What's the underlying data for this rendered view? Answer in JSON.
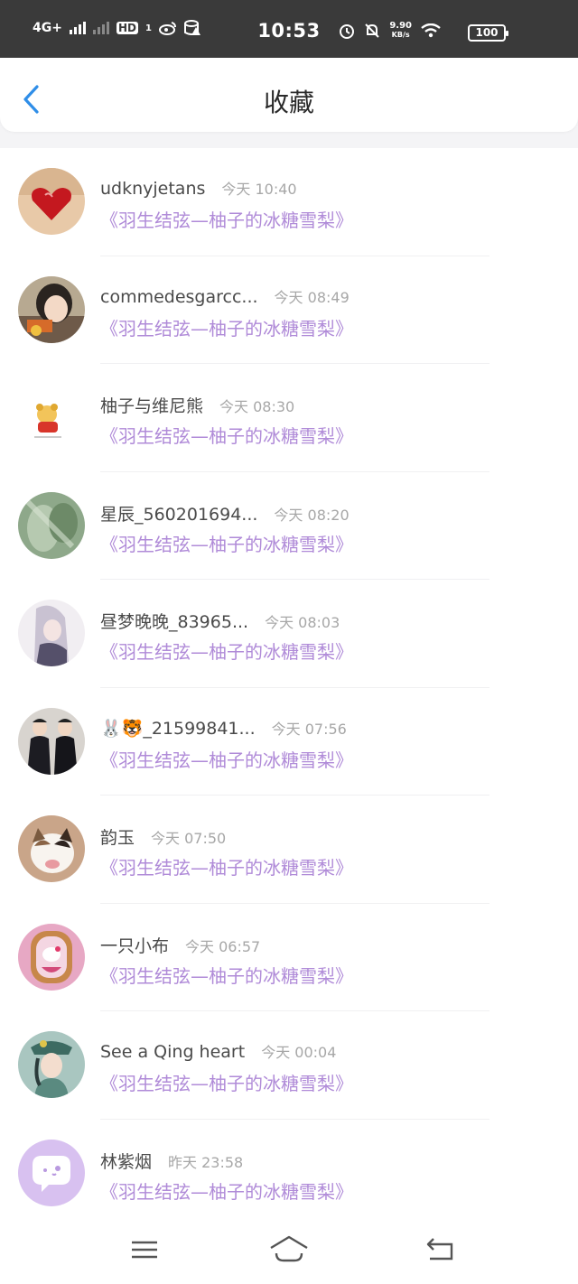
{
  "status_bar": {
    "network": "4G+",
    "hd": "HD",
    "sim": "1",
    "time": "10:53",
    "speed_value": "9.90",
    "speed_unit": "KB/s",
    "battery": "100"
  },
  "header": {
    "title": "收藏"
  },
  "items": [
    {
      "name": "udknyjetans",
      "time": "今天 10:40",
      "book": "《羽生结弦—柚子的冰糖雪梨》"
    },
    {
      "name": "commedesgarcc...",
      "time": "今天 08:49",
      "book": "《羽生结弦—柚子的冰糖雪梨》"
    },
    {
      "name": "柚子与维尼熊",
      "time": "今天 08:30",
      "book": "《羽生结弦—柚子的冰糖雪梨》"
    },
    {
      "name": "星辰_560201694...",
      "time": "今天 08:20",
      "book": "《羽生结弦—柚子的冰糖雪梨》"
    },
    {
      "name": "昼梦晚晚_83965...",
      "time": "今天 08:03",
      "book": "《羽生结弦—柚子的冰糖雪梨》"
    },
    {
      "name": "🐰🐯_21599841...",
      "time": "今天 07:56",
      "book": "《羽生结弦—柚子的冰糖雪梨》"
    },
    {
      "name": "韵玉",
      "time": "今天 07:50",
      "book": "《羽生结弦—柚子的冰糖雪梨》"
    },
    {
      "name": "一只小布",
      "time": "今天 06:57",
      "book": "《羽生结弦—柚子的冰糖雪梨》"
    },
    {
      "name": "See a Qing heart",
      "time": "今天 00:04",
      "book": "《羽生结弦—柚子的冰糖雪梨》"
    },
    {
      "name": "林紫烟",
      "time": "昨天 23:58",
      "book": "《羽生结弦—柚子的冰糖雪梨》"
    }
  ],
  "colors": {
    "accent_blue": "#2f8ee8",
    "book_purple": "#b08bd8",
    "status_bar_bg": "#3a3a3a"
  }
}
